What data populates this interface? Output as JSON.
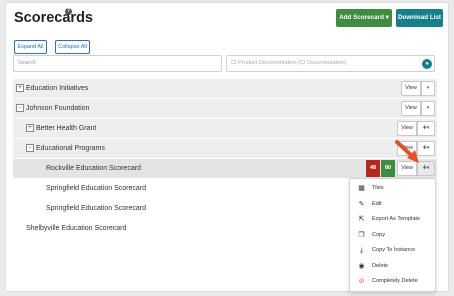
{
  "header": {
    "title": "Scorecards",
    "help_icon": "question-circle-icon",
    "add_label": "Add Scorecard",
    "download_label": "Download List"
  },
  "toolbar": {
    "expand_all": "Expand All",
    "collapse_all": "Collapse All",
    "search_placeholder": "Search",
    "filter_value": "CI Product Documentation (CI Documentation)"
  },
  "rows": [
    {
      "label": "Education Initiatives",
      "toggle": "+",
      "view": "View"
    },
    {
      "label": "Johnson Foundation",
      "toggle": "-",
      "view": "View"
    },
    {
      "label": "Better Health Grant",
      "toggle": "+",
      "view": "View"
    },
    {
      "label": "Educational Programs",
      "toggle": "-",
      "view": "View"
    },
    {
      "label": "Rockville Education Scorecard",
      "view": "View",
      "badge_red": "48",
      "badge_green": "80"
    },
    {
      "label": "Springfield Education Scorecard"
    },
    {
      "label": "Springfield Education Scorecard"
    },
    {
      "label": "Shelbyville Education Scorecard"
    }
  ],
  "menu": [
    {
      "label": "Tiles",
      "icon": "grid-icon"
    },
    {
      "label": "Edit",
      "icon": "pencil-icon"
    },
    {
      "label": "Export As Template",
      "icon": "export-icon"
    },
    {
      "label": "Copy",
      "icon": "copy-icon"
    },
    {
      "label": "Copy To Instance",
      "icon": "download-icon"
    },
    {
      "label": "Delete",
      "icon": "eye-slash-icon"
    },
    {
      "label": "Completely Delete",
      "icon": "ban-icon"
    }
  ],
  "colors": {
    "add_button": "#3f8b3f",
    "download_button": "#16808a",
    "badge_red": "#b02a22",
    "badge_green": "#3f8b3f",
    "arrow": "#e4502a"
  }
}
